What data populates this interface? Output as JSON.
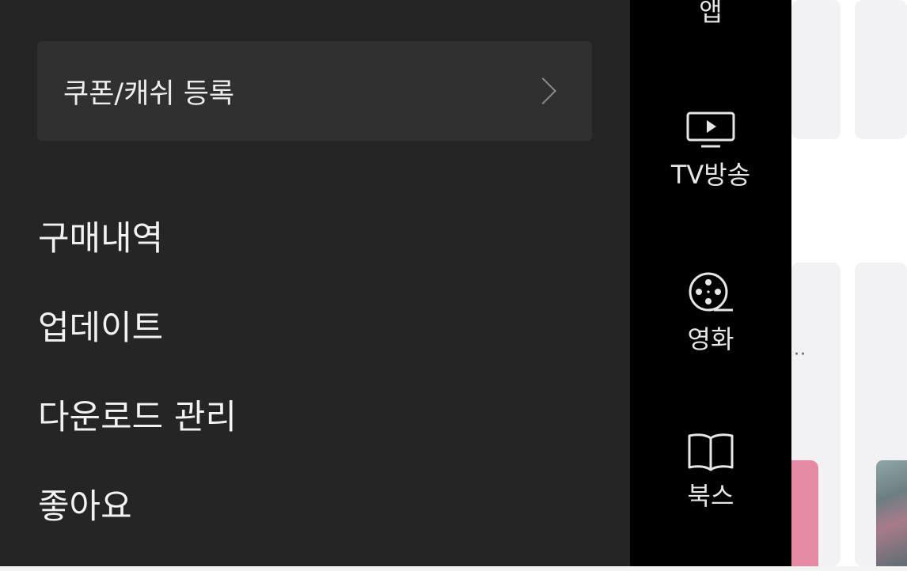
{
  "drawer": {
    "coupon": {
      "label": "쿠폰/캐쉬 등록"
    },
    "menu": [
      {
        "label": "구매내역"
      },
      {
        "label": "업데이트"
      },
      {
        "label": "다운로드 관리"
      },
      {
        "label": "좋아요"
      }
    ]
  },
  "rail": {
    "items": [
      {
        "label": "앱",
        "icon": "app-icon"
      },
      {
        "label": "TV방송",
        "icon": "tv-icon"
      },
      {
        "label": "영화",
        "icon": "film-reel-icon"
      },
      {
        "label": "북스",
        "icon": "book-icon"
      }
    ]
  },
  "background": {
    "more": "··"
  },
  "colors": {
    "drawer_bg": "#252525",
    "coupon_bg": "#303030",
    "rail_bg": "#000000",
    "text": "#f2f2f2"
  }
}
